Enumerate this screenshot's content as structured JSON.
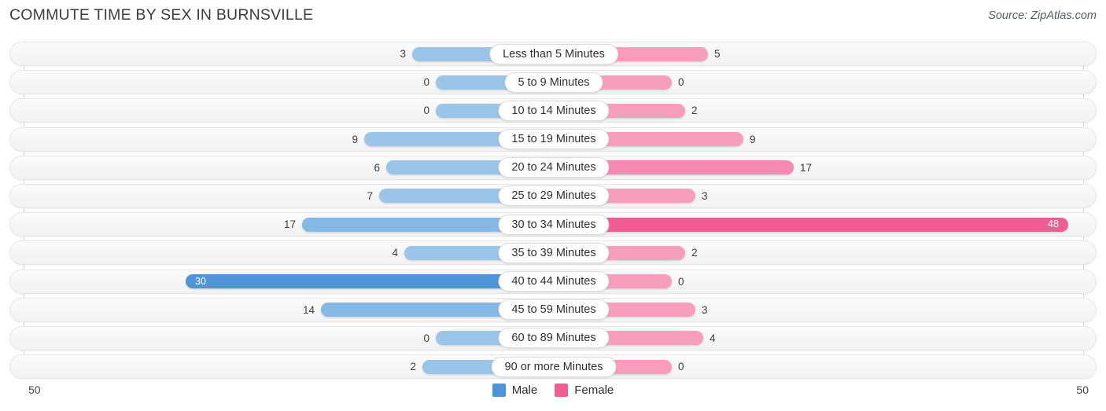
{
  "header": {
    "title": "COMMUTE TIME BY SEX IN BURNSVILLE",
    "source": "Source: ZipAtlas.com"
  },
  "axis": {
    "left_tick": "50",
    "right_tick": "50"
  },
  "legend": {
    "items": [
      {
        "label": "Male",
        "color": "#4e94d9"
      },
      {
        "label": "Female",
        "color": "#ef5e93"
      }
    ]
  },
  "chart_data": {
    "type": "bar",
    "orientation": "diverging-horizontal",
    "title": "COMMUTE TIME BY SEX IN BURNSVILLE",
    "xlabel": "",
    "ylabel": "",
    "xlim": [
      50,
      50
    ],
    "grid": false,
    "legend_position": "bottom-center",
    "categories": [
      "Less than 5 Minutes",
      "5 to 9 Minutes",
      "10 to 14 Minutes",
      "15 to 19 Minutes",
      "20 to 24 Minutes",
      "25 to 29 Minutes",
      "30 to 34 Minutes",
      "35 to 39 Minutes",
      "40 to 44 Minutes",
      "45 to 59 Minutes",
      "60 to 89 Minutes",
      "90 or more Minutes"
    ],
    "series": [
      {
        "name": "Male",
        "values": [
          3,
          0,
          0,
          9,
          6,
          7,
          17,
          4,
          30,
          14,
          0,
          2
        ]
      },
      {
        "name": "Female",
        "values": [
          5,
          0,
          2,
          9,
          17,
          3,
          48,
          2,
          0,
          3,
          4,
          0
        ]
      }
    ]
  },
  "rows": [
    {
      "label": "Less than 5 Minutes",
      "male": "3",
      "female": "5",
      "male_w": 180,
      "female_w": 196,
      "male_tone": "",
      "female_tone": "",
      "male_inside": false,
      "female_inside": false
    },
    {
      "label": "5 to 9 Minutes",
      "male": "0",
      "female": "0",
      "male_w": 150,
      "female_w": 150,
      "male_tone": "",
      "female_tone": "",
      "male_inside": false,
      "female_inside": false
    },
    {
      "label": "10 to 14 Minutes",
      "male": "0",
      "female": "2",
      "male_w": 150,
      "female_w": 167,
      "male_tone": "",
      "female_tone": "",
      "male_inside": false,
      "female_inside": false
    },
    {
      "label": "15 to 19 Minutes",
      "male": "9",
      "female": "9",
      "male_w": 241,
      "female_w": 241,
      "male_tone": "",
      "female_tone": "",
      "male_inside": false,
      "female_inside": false
    },
    {
      "label": "20 to 24 Minutes",
      "male": "6",
      "female": "17",
      "male_w": 213,
      "female_w": 305,
      "male_tone": "",
      "female_tone": "mid",
      "male_inside": false,
      "female_inside": false
    },
    {
      "label": "25 to 29 Minutes",
      "male": "7",
      "female": "3",
      "male_w": 222,
      "female_w": 180,
      "male_tone": "",
      "female_tone": "",
      "male_inside": false,
      "female_inside": false
    },
    {
      "label": "30 to 34 Minutes",
      "male": "17",
      "female": "48",
      "male_w": 320,
      "female_w": 654,
      "male_tone": "mid",
      "female_tone": "hi",
      "male_inside": false,
      "female_inside": true
    },
    {
      "label": "35 to 39 Minutes",
      "male": "4",
      "female": "2",
      "male_w": 190,
      "female_w": 167,
      "male_tone": "",
      "female_tone": "",
      "male_inside": false,
      "female_inside": false
    },
    {
      "label": "40 to 44 Minutes",
      "male": "30",
      "female": "0",
      "male_w": 468,
      "female_w": 150,
      "male_tone": "hi",
      "female_tone": "",
      "male_inside": true,
      "female_inside": false
    },
    {
      "label": "45 to 59 Minutes",
      "male": "14",
      "female": "3",
      "male_w": 296,
      "female_w": 180,
      "male_tone": "mid",
      "female_tone": "",
      "male_inside": false,
      "female_inside": false
    },
    {
      "label": "60 to 89 Minutes",
      "male": "0",
      "female": "4",
      "male_w": 150,
      "female_w": 190,
      "male_tone": "",
      "female_tone": "",
      "male_inside": false,
      "female_inside": false
    },
    {
      "label": "90 or more Minutes",
      "male": "2",
      "female": "0",
      "male_w": 167,
      "female_w": 150,
      "male_tone": "",
      "female_tone": "",
      "male_inside": false,
      "female_inside": false
    }
  ]
}
